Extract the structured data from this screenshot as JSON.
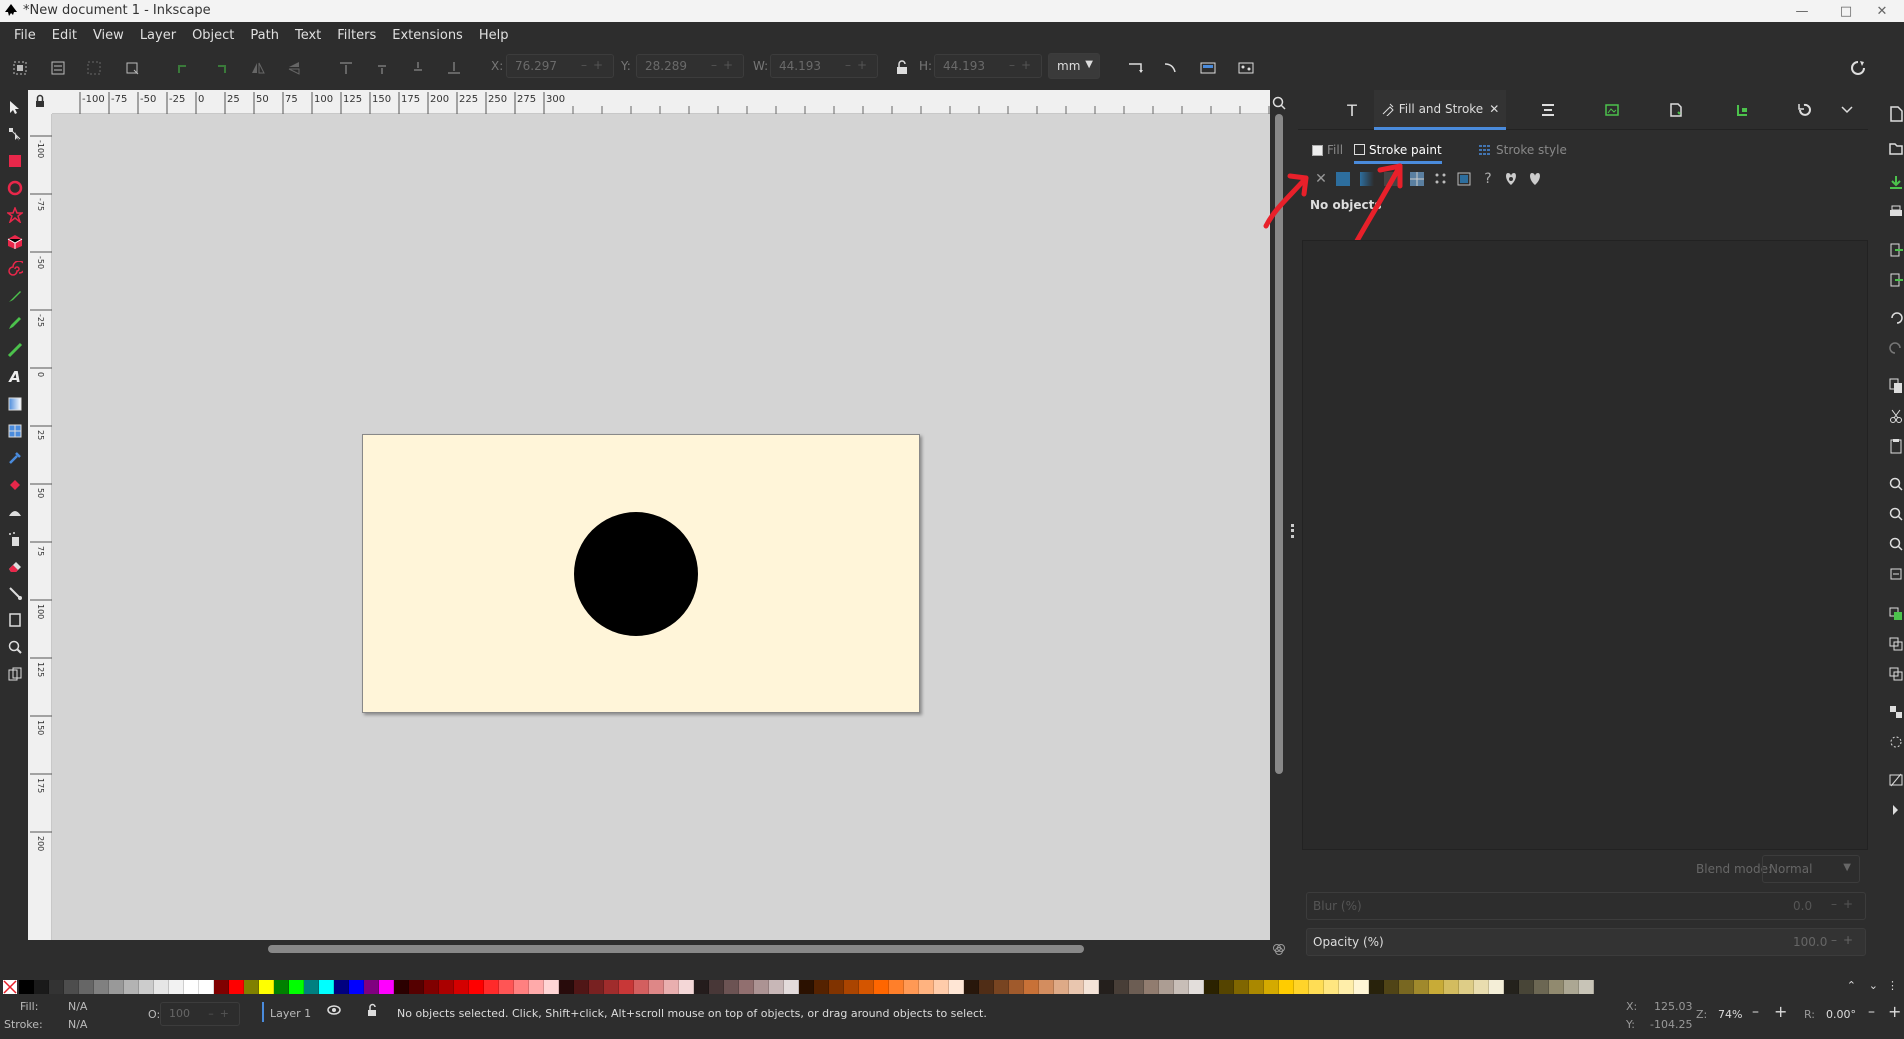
{
  "window": {
    "title": "*New document 1 - Inkscape"
  },
  "menu": [
    "File",
    "Edit",
    "View",
    "Layer",
    "Object",
    "Path",
    "Text",
    "Filters",
    "Extensions",
    "Help"
  ],
  "selector_toolbar": {
    "x": {
      "label": "X:",
      "value": "76.297"
    },
    "y": {
      "label": "Y:",
      "value": "28.289"
    },
    "w": {
      "label": "W:",
      "value": "44.193"
    },
    "h": {
      "label": "H:",
      "value": "44.193"
    },
    "unit": "mm"
  },
  "ruler_h_ticks": [
    "-100",
    "-75",
    "-50",
    "-25",
    "0",
    "25",
    "50",
    "75",
    "100",
    "125",
    "150",
    "175",
    "200",
    "225",
    "250",
    "275",
    "300"
  ],
  "ruler_v_ticks": [
    "-100",
    "-75",
    "-50",
    "-25",
    "0",
    "25",
    "50",
    "75",
    "100",
    "125",
    "150",
    "175",
    "200"
  ],
  "dock": {
    "active_tab": "Fill and Stroke",
    "subtabs": {
      "fill": "Fill",
      "stroke_paint": "Stroke paint",
      "stroke_style": "Stroke style"
    },
    "message": "No objects",
    "blend_label": "Blend mode:",
    "blend_value": "Normal",
    "blur_label": "Blur (%)",
    "blur_value": "0.0",
    "opacity_label": "Opacity (%)",
    "opacity_value": "100.0"
  },
  "status": {
    "fill_label": "Fill:",
    "fill_value": "N/A",
    "stroke_label": "Stroke:",
    "stroke_value": "N/A",
    "o_label": "O:",
    "o_value": "100",
    "layer": "Layer 1",
    "message": "No objects selected. Click, Shift+click, Alt+scroll mouse on top of objects, or drag around objects to select.",
    "x_label": "X:",
    "x_value": "125.03",
    "y_label": "Y:",
    "y_value": "-104.25",
    "z_label": "Z:",
    "zoom": "74%",
    "r_label": "R:",
    "rotation": "0.00°"
  },
  "palette": [
    "#000000",
    "#1a1a1a",
    "#333333",
    "#4d4d4d",
    "#666666",
    "#808080",
    "#999999",
    "#b3b3b3",
    "#cccccc",
    "#e6e6e6",
    "#f2f2f2",
    "#ffffff",
    "#ffffff",
    "#800000",
    "#ff0000",
    "#808000",
    "#ffff00",
    "#008000",
    "#00ff00",
    "#008080",
    "#00ffff",
    "#000080",
    "#0000ff",
    "#800080",
    "#ff00ff",
    "#2b0000",
    "#550000",
    "#800000",
    "#aa0000",
    "#d40000",
    "#ff0000",
    "#ff2a2a",
    "#ff5555",
    "#ff8080",
    "#ffaaaa",
    "#ffd5d5",
    "#280b0b",
    "#501616",
    "#782121",
    "#a02c2c",
    "#c83737",
    "#d35f5f",
    "#de8787",
    "#e9afaf",
    "#f4d7d7",
    "#241c1c",
    "#483737",
    "#6c5353",
    "#916f6f",
    "#ac9393",
    "#c8b7b7",
    "#e3dbdb",
    "#2b1100",
    "#552200",
    "#803300",
    "#aa4400",
    "#d45500",
    "#ff6600",
    "#ff7f2a",
    "#ff9955",
    "#ffb380",
    "#ffccaa",
    "#ffe6d5",
    "#28170b",
    "#502d16",
    "#784421",
    "#a05a2c",
    "#c87137",
    "#d38d5f",
    "#deaa87",
    "#e9c6af",
    "#f4e3d7",
    "#241f1c",
    "#483e37",
    "#6c5d53",
    "#917c6f",
    "#ac9d93",
    "#c8beb7",
    "#e3dedb",
    "#2b2200",
    "#554400",
    "#806600",
    "#aa8800",
    "#d4aa00",
    "#ffcc00",
    "#ffd42a",
    "#ffdd55",
    "#ffe680",
    "#ffeeaa",
    "#fff6d5",
    "#28220b",
    "#504416",
    "#786721",
    "#a0892c",
    "#c8ab37",
    "#d3bc5f",
    "#decd87",
    "#e9ddaf",
    "#f4eed7",
    "#24221c",
    "#484537",
    "#6c6753",
    "#918a6f",
    "#aca793",
    "#c8c4b7"
  ]
}
